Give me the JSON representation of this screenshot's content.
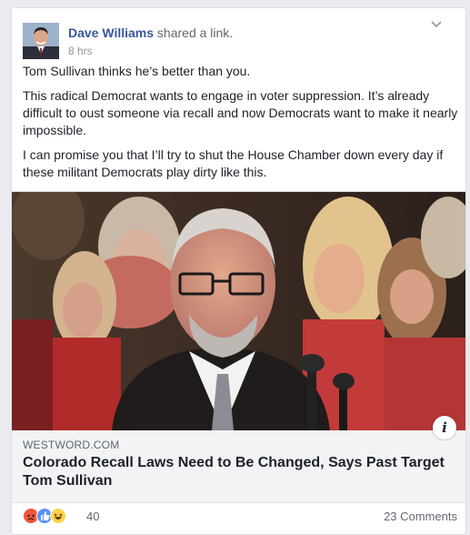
{
  "post": {
    "author": "Dave Williams",
    "action": " shared a link.",
    "time": "8 hrs",
    "paragraphs": [
      "Tom Sullivan thinks he’s better than you.",
      "This radical Democrat wants to engage in voter suppression. It’s already difficult to oust someone via recall and now Democrats want to make it nearly impossible.",
      "I can promise you that I’ll try to shut the House Chamber down every day if these militant Democrats play dirty like this."
    ]
  },
  "link": {
    "domain": "WESTWORD.COM",
    "title": "Colorado Recall Laws Need to Be Changed, Says Past Target Tom Sullivan",
    "info_label": "i"
  },
  "footer": {
    "reaction_icons": [
      "angry-icon",
      "like-icon",
      "haha-icon"
    ],
    "reaction_count": "40",
    "comments": "23 Comments"
  },
  "colors": {
    "author_link": "#365899",
    "like_blue": "#5890ff",
    "angry_orange": "#f0563a",
    "haha_yellow": "#fcd34d"
  }
}
